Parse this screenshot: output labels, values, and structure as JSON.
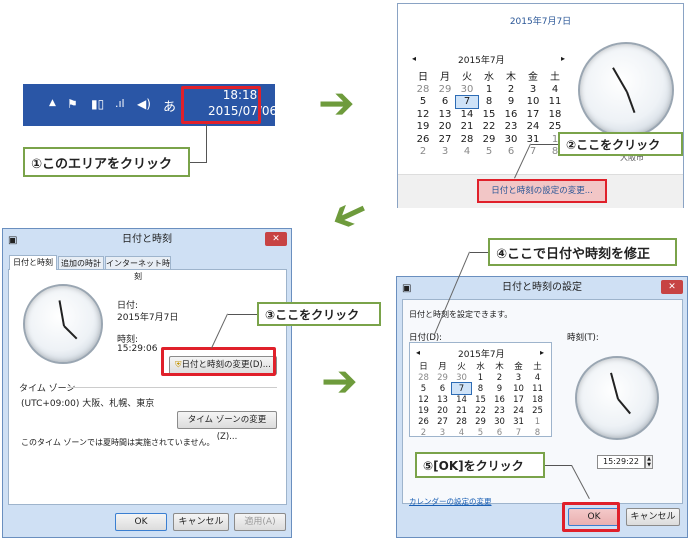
{
  "taskbar": {
    "time": "18:18",
    "date": "2015/07/06",
    "ime": "あ",
    "icons": [
      "chevron-up-icon",
      "flag-icon",
      "power-icon",
      "signal-icon",
      "volume-icon"
    ]
  },
  "callouts": {
    "c1": "①このエリアをクリック",
    "c2": "②ここをクリック",
    "c3": "③ここをクリック",
    "c4": "④ここで日付や時刻を修正",
    "c5": "⑤[OK]をクリック"
  },
  "popup": {
    "heading": "2015年7月7日",
    "month": "2015年7月",
    "change_link": "日付と時刻の設定の変更...",
    "partial_text": "大阪市"
  },
  "calendar": {
    "weekdays": [
      "日",
      "月",
      "火",
      "水",
      "木",
      "金",
      "土"
    ],
    "rows": [
      [
        "28",
        "29",
        "30",
        "1",
        "2",
        "3",
        "4"
      ],
      [
        "5",
        "6",
        "7",
        "8",
        "9",
        "10",
        "11"
      ],
      [
        "12",
        "13",
        "14",
        "15",
        "16",
        "17",
        "18"
      ],
      [
        "19",
        "20",
        "21",
        "22",
        "23",
        "24",
        "25"
      ],
      [
        "26",
        "27",
        "28",
        "29",
        "30",
        "31",
        "1"
      ],
      [
        "2",
        "3",
        "4",
        "5",
        "6",
        "7",
        "8"
      ]
    ]
  },
  "dialog1": {
    "title": "日付と時刻",
    "tabs": [
      "日付と時刻",
      "追加の時計",
      "インターネット時刻"
    ],
    "date_label": "日付:",
    "date_value": "2015年7月7日",
    "time_label": "時刻:",
    "time_value": "15:29:06",
    "change_btn": "日付と時刻の変更(D)...",
    "tz_heading": "タイム ゾーン",
    "tz_value": "(UTC+09:00) 大阪、札幌、東京",
    "tz_btn": "タイム ゾーンの変更(Z)...",
    "dst_note": "このタイム ゾーンでは夏時間は実施されていません。",
    "ok": "OK",
    "cancel": "キャンセル",
    "apply": "適用(A)"
  },
  "dialog2": {
    "title": "日付と時刻の設定",
    "intro": "日付と時刻を設定できます。",
    "date_label": "日付(D):",
    "time_label": "時刻(T):",
    "month": "2015年7月",
    "time_value": "15:29:22",
    "calendar_link": "カレンダーの設定の変更",
    "ok": "OK",
    "cancel": "キャンセル"
  },
  "colors": {
    "accent_green": "#7aa34a",
    "highlight_red": "#e0202a",
    "taskbar_blue": "#2a56a6"
  }
}
